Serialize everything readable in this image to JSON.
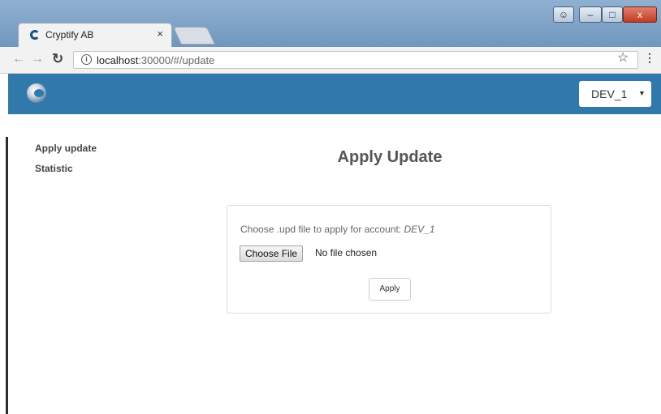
{
  "browser": {
    "tab_title": "Cryptify AB",
    "tab_close": "×",
    "url_host": "localhost",
    "url_path": ":30000/#/update",
    "window_controls": {
      "close": "x"
    }
  },
  "header": {
    "account_value": "DEV_1",
    "caret": "▼",
    "brand_color": "#3079aa"
  },
  "sidebar": {
    "items": [
      {
        "label": "Apply update"
      },
      {
        "label": "Statistic"
      }
    ]
  },
  "main": {
    "title": "Apply Update",
    "prompt_text": "Choose .upd file to apply for account: ",
    "prompt_account": "DEV_1",
    "file_button_label": "Choose File",
    "file_status": "No file chosen",
    "apply_label": "Apply"
  }
}
